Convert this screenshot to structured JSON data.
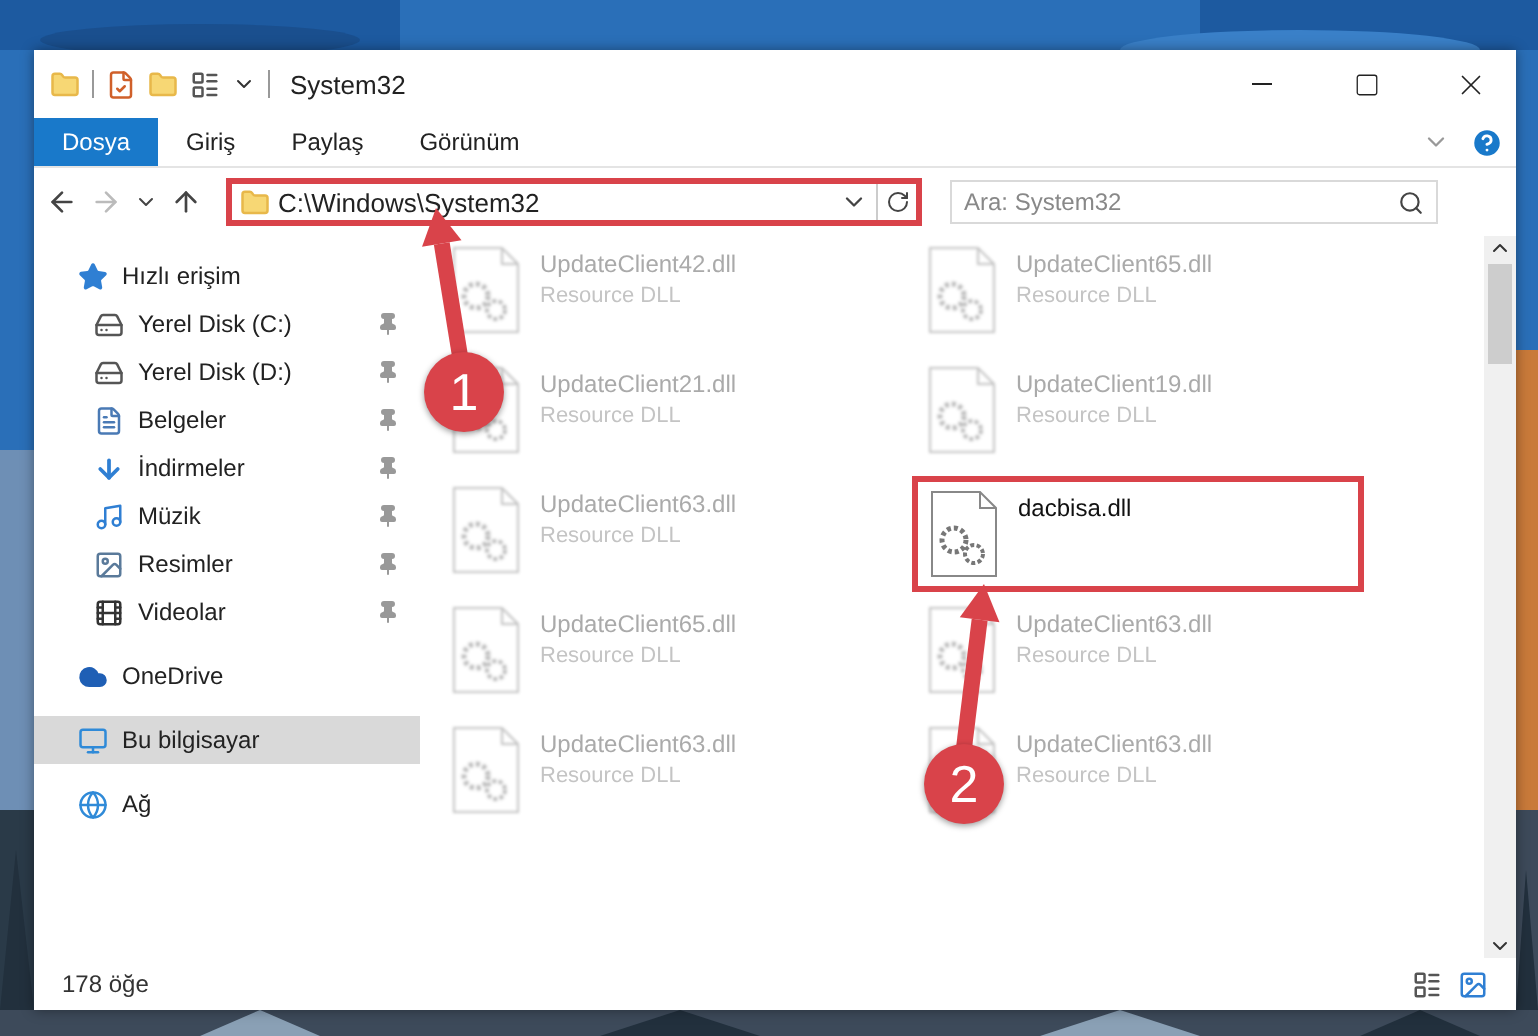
{
  "window": {
    "title": "System32"
  },
  "ribbon_tabs": [
    {
      "label": "Dosya",
      "selected": true
    },
    {
      "label": "Giriş",
      "selected": false
    },
    {
      "label": "Paylaş",
      "selected": false
    },
    {
      "label": "Görünüm",
      "selected": false
    }
  ],
  "address_bar": {
    "path": "C:\\Windows\\System32",
    "highlighted": true
  },
  "search": {
    "placeholder": "Ara: System32"
  },
  "sidebar": {
    "items": [
      {
        "label": "Hızlı erişim",
        "selected": false,
        "children": [
          {
            "label": "Yerel Disk (C:)",
            "pinned": true,
            "selected": false
          },
          {
            "label": "Yerel Disk (D:)",
            "pinned": true,
            "selected": false
          },
          {
            "label": "Belgeler",
            "pinned": true,
            "selected": false
          },
          {
            "label": "İndirmeler",
            "pinned": true,
            "selected": false
          },
          {
            "label": "Müzik",
            "pinned": true,
            "selected": false
          },
          {
            "label": "Resimler",
            "pinned": true,
            "selected": false
          },
          {
            "label": "Videolar",
            "pinned": true,
            "selected": false
          }
        ]
      },
      {
        "label": "OneDrive",
        "selected": false
      },
      {
        "label": "Bu bilgisayar",
        "selected": true
      },
      {
        "label": "Ağ",
        "selected": false
      }
    ]
  },
  "files": [
    {
      "name": "UpdateClient42.dll",
      "type": "Resource DLL",
      "highlighted": false
    },
    {
      "name": "UpdateClient65.dll",
      "type": "Resource DLL",
      "highlighted": false
    },
    {
      "name": "UpdateClient21.dll",
      "type": "Resource DLL",
      "highlighted": false
    },
    {
      "name": "UpdateClient19.dll",
      "type": "Resource DLL",
      "highlighted": false
    },
    {
      "name": "UpdateClient63.dll",
      "type": "Resource DLL",
      "highlighted": false
    },
    {
      "name": "dacbisa.dll",
      "highlighted": true
    },
    {
      "name": "UpdateClient65.dll",
      "type": "Resource DLL",
      "highlighted": false
    },
    {
      "name": "UpdateClient63.dll",
      "type": "Resource DLL",
      "highlighted": false
    },
    {
      "name": "UpdateClient63.dll",
      "type": "Resource DLL",
      "highlighted": false
    },
    {
      "name": "UpdateClient63.dll",
      "type": "Resource DLL",
      "highlighted": false
    }
  ],
  "callouts": [
    {
      "number": "1"
    },
    {
      "number": "2"
    }
  ],
  "status_bar": {
    "item_count": "178 öğe"
  }
}
